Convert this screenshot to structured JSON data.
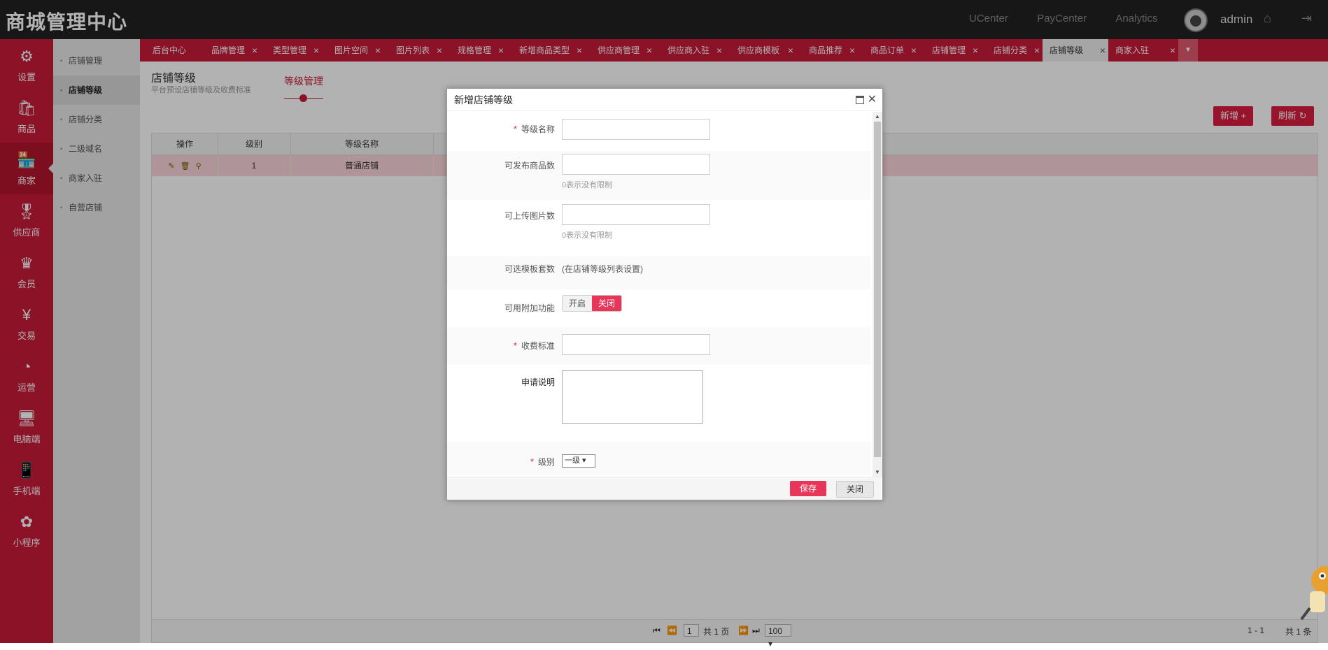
{
  "header": {
    "title": "商城管理中心",
    "links": [
      "UCenter",
      "PayCenter",
      "Analytics"
    ],
    "username": "admin"
  },
  "leftnav": [
    {
      "label": "设置",
      "icon": "gear-icon"
    },
    {
      "label": "商品",
      "icon": "bag-icon"
    },
    {
      "label": "商家",
      "icon": "store-icon",
      "active": true
    },
    {
      "label": "供应商",
      "icon": "award-icon"
    },
    {
      "label": "会员",
      "icon": "crown-icon"
    },
    {
      "label": "交易",
      "icon": "yen-icon"
    },
    {
      "label": "运营",
      "icon": "pie-icon"
    },
    {
      "label": "电脑端",
      "icon": "monitor-icon"
    },
    {
      "label": "手机端",
      "icon": "mobile-icon"
    },
    {
      "label": "小程序",
      "icon": "miniapp-icon"
    }
  ],
  "subnav": [
    "店铺管理",
    "店铺等级",
    "店铺分类",
    "二级域名",
    "商家入驻",
    "自营店铺"
  ],
  "tabs": [
    "后台中心",
    "品牌管理",
    "类型管理",
    "图片空间",
    "图片列表",
    "规格管理",
    "新增商品类型",
    "供应商管理",
    "供应商入驻",
    "供应商模板",
    "商品推荐",
    "商品订单",
    "店铺管理",
    "店铺分类",
    "店铺等级",
    "商家入驻"
  ],
  "page": {
    "title": "店铺等级",
    "subtitle": "平台预设店铺等级及收费标准",
    "section_tab": "等级管理",
    "add_button": "新增 +",
    "refresh_button": "刷新 ↻"
  },
  "grid": {
    "columns": [
      "操作",
      "级别",
      "等级名称"
    ],
    "rows": [
      {
        "level": "1",
        "name": "普通店铺"
      }
    ],
    "pager": {
      "page": "1",
      "total_pages": "共 1 页",
      "page_size": "100",
      "range": "1 - 1",
      "total": "共 1 条"
    }
  },
  "dialog": {
    "title": "新增店铺等级",
    "fields": {
      "grade_name": "等级名称",
      "goods_limit": "可发布商品数",
      "goods_hint": "0表示没有限制",
      "image_limit": "可上传图片数",
      "image_hint": "0表示没有限制",
      "template_label": "可选模板套数",
      "template_text": "(在店铺等级列表设置)",
      "addon_label": "可用附加功能",
      "addon_on": "开启",
      "addon_off": "关闭",
      "fee_label": "收费标准",
      "desc_label": "申请说明",
      "level_label": "级别",
      "level_value": "一级"
    },
    "save": "保存",
    "close": "关闭"
  }
}
